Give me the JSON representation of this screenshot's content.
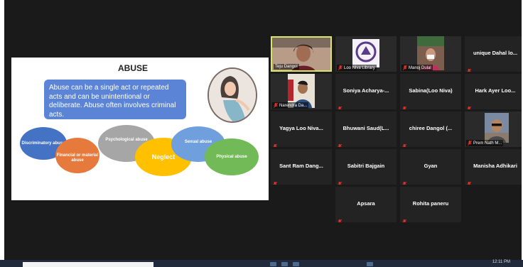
{
  "slide": {
    "title": "ABUSE",
    "box_text": "Abuse can be a single act or repeated acts and can be unintentional or deliberate. Abuse often involves criminal acts.",
    "ellipses": [
      {
        "label": "Discriminatory abuse",
        "color": "#4472c4"
      },
      {
        "label": "Financial or material abuse",
        "color": "#e67a3c"
      },
      {
        "label": "Psychological abuse",
        "color": "#a6a6a6"
      },
      {
        "label": "Neglect",
        "color": "#ffc000"
      },
      {
        "label": "Sexual abuse",
        "color": "#6fa0dd"
      },
      {
        "label": "Physical abuse",
        "color": "#72b957"
      }
    ]
  },
  "participants": [
    {
      "name": "Teju Dangol",
      "video": true
    },
    {
      "name": "Loo Niva Library",
      "video": true
    },
    {
      "name": "Manoj Dulal",
      "video": true
    },
    {
      "name": "unique Dahal lo...",
      "video": false
    },
    {
      "name": "Narendra Da...",
      "video": true
    },
    {
      "name": "Soniya Acharya-...",
      "video": false
    },
    {
      "name": "Sabina(Loo Niva)",
      "video": false
    },
    {
      "name": "Hark Ayer Loo...",
      "video": false
    },
    {
      "name": "Yagya Loo Niva...",
      "video": false
    },
    {
      "name": "Bhuwani Saud(L...",
      "video": false
    },
    {
      "name": "chiree Dangol (...",
      "video": false
    },
    {
      "name": "Prem Nath M...",
      "video": true
    },
    {
      "name": "Sant Ram Dang...",
      "video": false
    },
    {
      "name": "Sabitri Bajgain",
      "video": false
    },
    {
      "name": "Gyan",
      "video": false
    },
    {
      "name": "Manisha Adhikari",
      "video": false
    },
    {
      "name": "Apsara",
      "video": false
    },
    {
      "name": "Rohita paneru",
      "video": false
    }
  ],
  "taskbar": {
    "clock": "12:11 PM"
  },
  "colors": {
    "mic_muted": "#e0302b",
    "active_speaker": "#d8e46a"
  }
}
